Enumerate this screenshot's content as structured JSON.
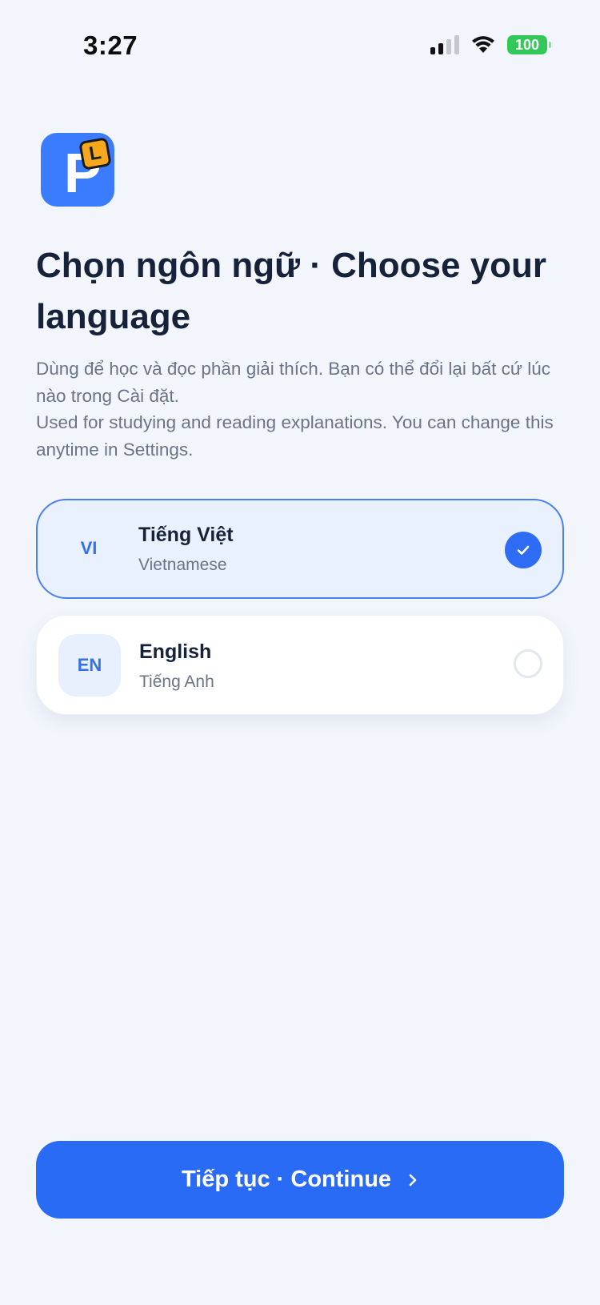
{
  "status_bar": {
    "time": "3:27",
    "battery": "100",
    "battery_color": "#34c759"
  },
  "app": {
    "logo_letter": "P",
    "logo_badge_letter": "L",
    "logo_color": "#3b7cff"
  },
  "header": {
    "title": "Chọn ngôn ngữ · Choose your language",
    "subtitle_vi": "Dùng để học và đọc phần giải thích. Bạn có thể đổi lại bất cứ lúc nào trong Cài đặt.",
    "subtitle_en": "Used for studying and reading explanations. You can change this anytime in Settings."
  },
  "languages": [
    {
      "code": "VI",
      "name": "Tiếng Việt",
      "subtitle": "Vietnamese",
      "selected": true
    },
    {
      "code": "EN",
      "name": "English",
      "subtitle": "Tiếng Anh",
      "selected": false
    }
  ],
  "footer": {
    "continue_label": "Tiếp tục · Continue"
  },
  "colors": {
    "accent": "#2a6bf6",
    "background": "#f2f6fc",
    "selected_background": "#e9f0fe"
  }
}
